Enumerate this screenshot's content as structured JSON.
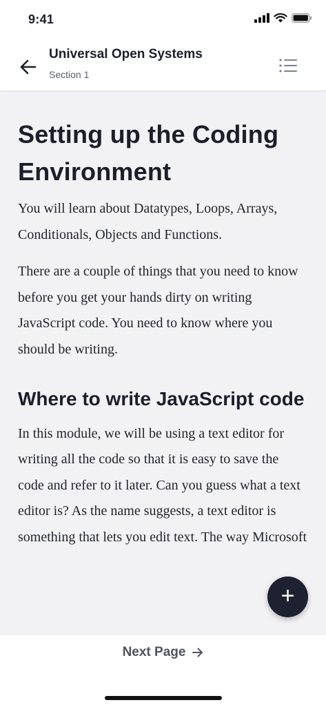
{
  "status_bar": {
    "time": "9:41",
    "icons": [
      "signal-icon",
      "wifi-icon",
      "battery-icon"
    ]
  },
  "header": {
    "title": "Universal Open Systems",
    "subtitle": "Section 1",
    "back_icon": "arrow-left-icon",
    "menu_icon": "list-icon"
  },
  "article": {
    "title": "Setting up the Coding Environment",
    "paragraphs": [
      "You will learn about Datatypes, Loops, Arrays, Conditionals, Objects and Functions.",
      "There are a couple of things that you need to know before you get your hands dirty on writing JavaScript code. You need to know where you should be writing."
    ],
    "subheading": "Where to write JavaScript code",
    "body": "In this module, we will be using a text editor for writing all the code so that it is easy to save the code and refer to it later. Can you guess what a text editor is? As the name suggests, a text editor is something that lets you edit text. The way Microsoft"
  },
  "fab": {
    "label": "+",
    "icon": "plus-icon"
  },
  "footer": {
    "next_label": "Next Page",
    "next_icon": "arrow-right-icon"
  },
  "colors": {
    "background": "#f2f2f5",
    "surface": "#ffffff",
    "text": "#1c1f2a",
    "fab": "#1e2230"
  }
}
